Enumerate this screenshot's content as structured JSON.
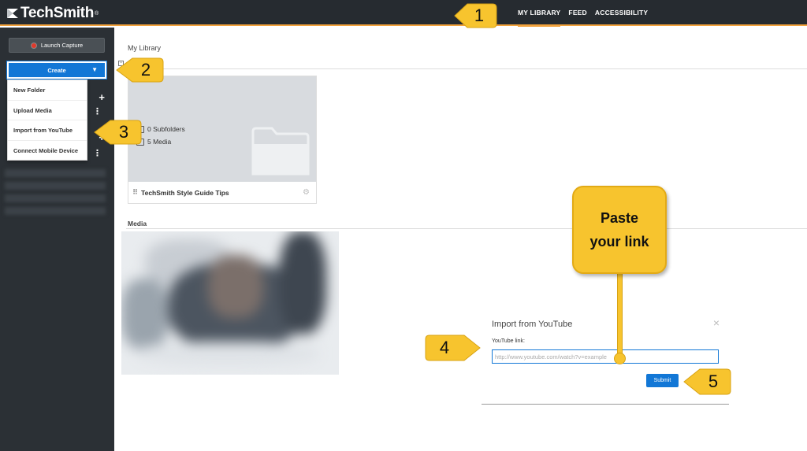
{
  "topbar": {
    "brand": "TechSmith",
    "brand_mark": "®",
    "nav": [
      "MY LIBRARY",
      "FEED",
      "ACCESSIBILITY"
    ],
    "active": "MY LIBRARY",
    "accent_color": "#f2a23c"
  },
  "sidebar": {
    "launch_label": "Launch Capture",
    "create_label": "Create",
    "create_caret": "▼",
    "menu": [
      "New Folder",
      "Upload Media",
      "Import from YouTube",
      "Connect Mobile Device"
    ]
  },
  "main": {
    "title": "My Library",
    "folder": {
      "subfolders": "0 Subfolders",
      "media": "5 Media",
      "name": "TechSmith Style Guide Tips"
    },
    "media_section": "Media"
  },
  "dialog": {
    "title": "Import from YouTube",
    "field_label": "YouTube link:",
    "placeholder": "http://www.youtube.com/watch?v=example",
    "submit_label": "Submit",
    "close_glyph": "×"
  },
  "callouts": {
    "steps": [
      "1",
      "2",
      "3",
      "4",
      "5"
    ],
    "note_line1": "Paste",
    "note_line2": "your link",
    "color": "#f7c42e"
  },
  "icons": [
    "techsmith-logo-icon",
    "record-icon",
    "caret-down-icon",
    "plus-icon",
    "more-icon",
    "folder-icon",
    "grip-icon",
    "gear-icon",
    "close-icon"
  ]
}
